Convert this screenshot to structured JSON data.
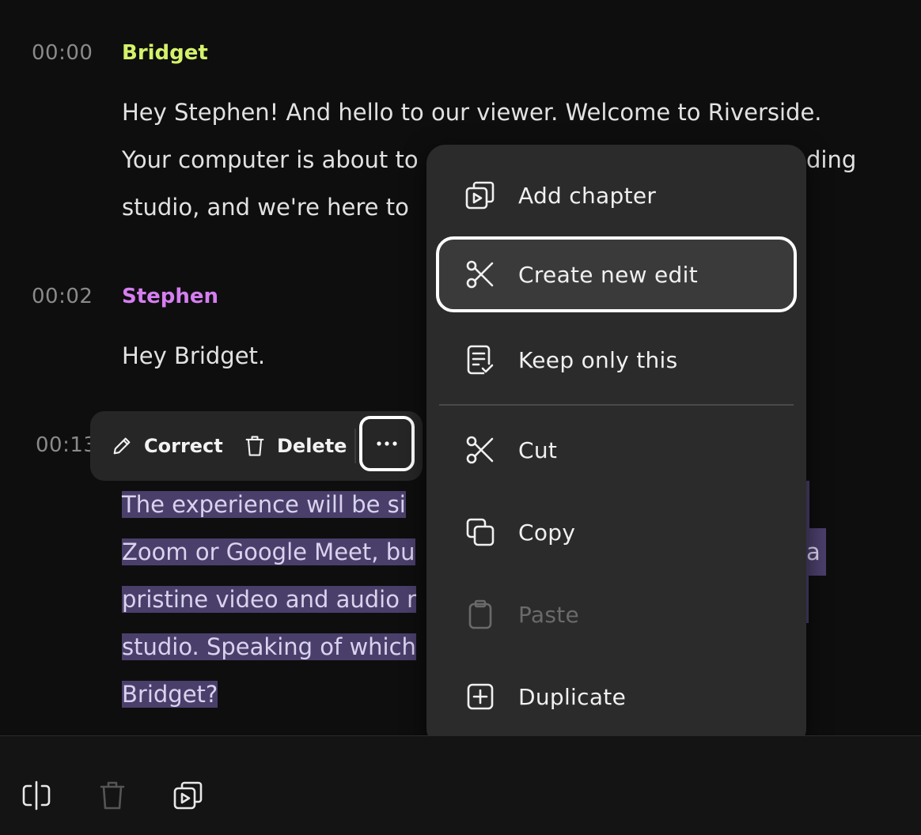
{
  "transcript": {
    "segments": [
      {
        "timestamp": "00:00",
        "speaker": "Bridget",
        "speaker_color": "#d4f26a",
        "lines": [
          "Hey Stephen! And hello to our viewer. Welcome to Riverside.",
          "Your computer is about to",
          "studio, and we're here to"
        ],
        "line1_tail": "ding"
      },
      {
        "timestamp": "00:02",
        "speaker": "Stephen",
        "speaker_color": "#d67ef0",
        "lines": [
          "Hey Bridget."
        ]
      },
      {
        "timestamp": "00:13",
        "lines": [
          "The experience will be si",
          "Zoom or Google Meet, bu",
          "pristine video and audio r",
          "studio. Speaking of which",
          "Bridget?"
        ],
        "line1_tail": "a"
      }
    ]
  },
  "inline_toolbar": {
    "correct_label": "Correct",
    "delete_label": "Delete",
    "more_icon": "more-horizontal-icon"
  },
  "context_menu": {
    "items": [
      {
        "label": "Add chapter",
        "icon": "add-chapter-icon"
      },
      {
        "label": "Create new edit",
        "icon": "scissors-icon",
        "focused": true
      },
      {
        "label": "Keep only this",
        "icon": "keep-only-icon"
      },
      {
        "label": "Cut",
        "icon": "scissors-icon"
      },
      {
        "label": "Copy",
        "icon": "copy-icon"
      },
      {
        "label": "Paste",
        "icon": "clipboard-icon",
        "disabled": true
      },
      {
        "label": "Duplicate",
        "icon": "duplicate-icon"
      }
    ]
  },
  "bottom_bar": {
    "icons": [
      "split-icon",
      "trash-icon",
      "add-chapter-icon"
    ]
  },
  "colors": {
    "background": "#0e0e0f",
    "highlight": "#4a3f6b",
    "menu_bg": "#2b2b2b"
  }
}
